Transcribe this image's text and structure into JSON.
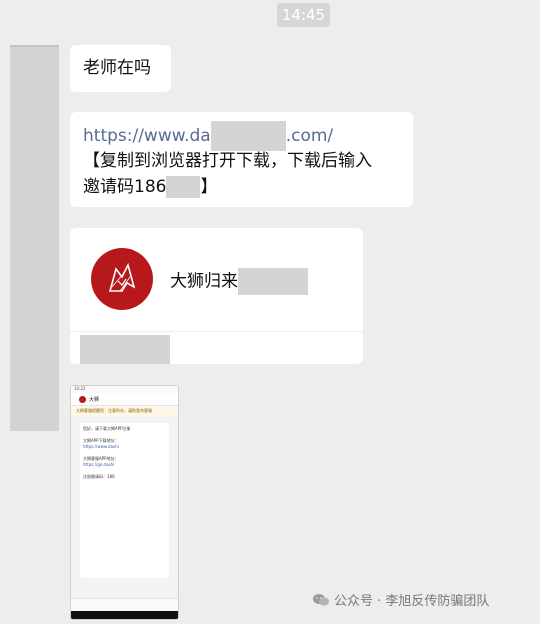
{
  "chat": {
    "timestamp": "14:45",
    "messages": {
      "greeting": "老师在吗",
      "link_prefix": "https://www.da",
      "link_suffix": ".com/",
      "instruction_line1": "【复制到浏览器打开下载，下载后输入",
      "instruction_line2_prefix": "邀请码186",
      "instruction_line2_suffix": "】"
    },
    "card": {
      "name": "大狮归来"
    },
    "screenshot": {
      "status_time": "10:22",
      "topbar_title": "大狮",
      "notice": "大狮客服提醒您：注意防诈，谨防冒充客服",
      "lines": [
        "您好，请下载大狮APP注册",
        "大狮APP下载地址：",
        "https://www.dashi",
        "大狮客服APP地址：",
        "https://go.dashi",
        "注册邀请码：186"
      ]
    }
  },
  "watermark": {
    "text": "公众号 · 李旭反传防骗团队"
  },
  "colors": {
    "background": "#ededed",
    "bubble": "#ffffff",
    "link": "#576b95",
    "brand_red": "#b7181b"
  }
}
